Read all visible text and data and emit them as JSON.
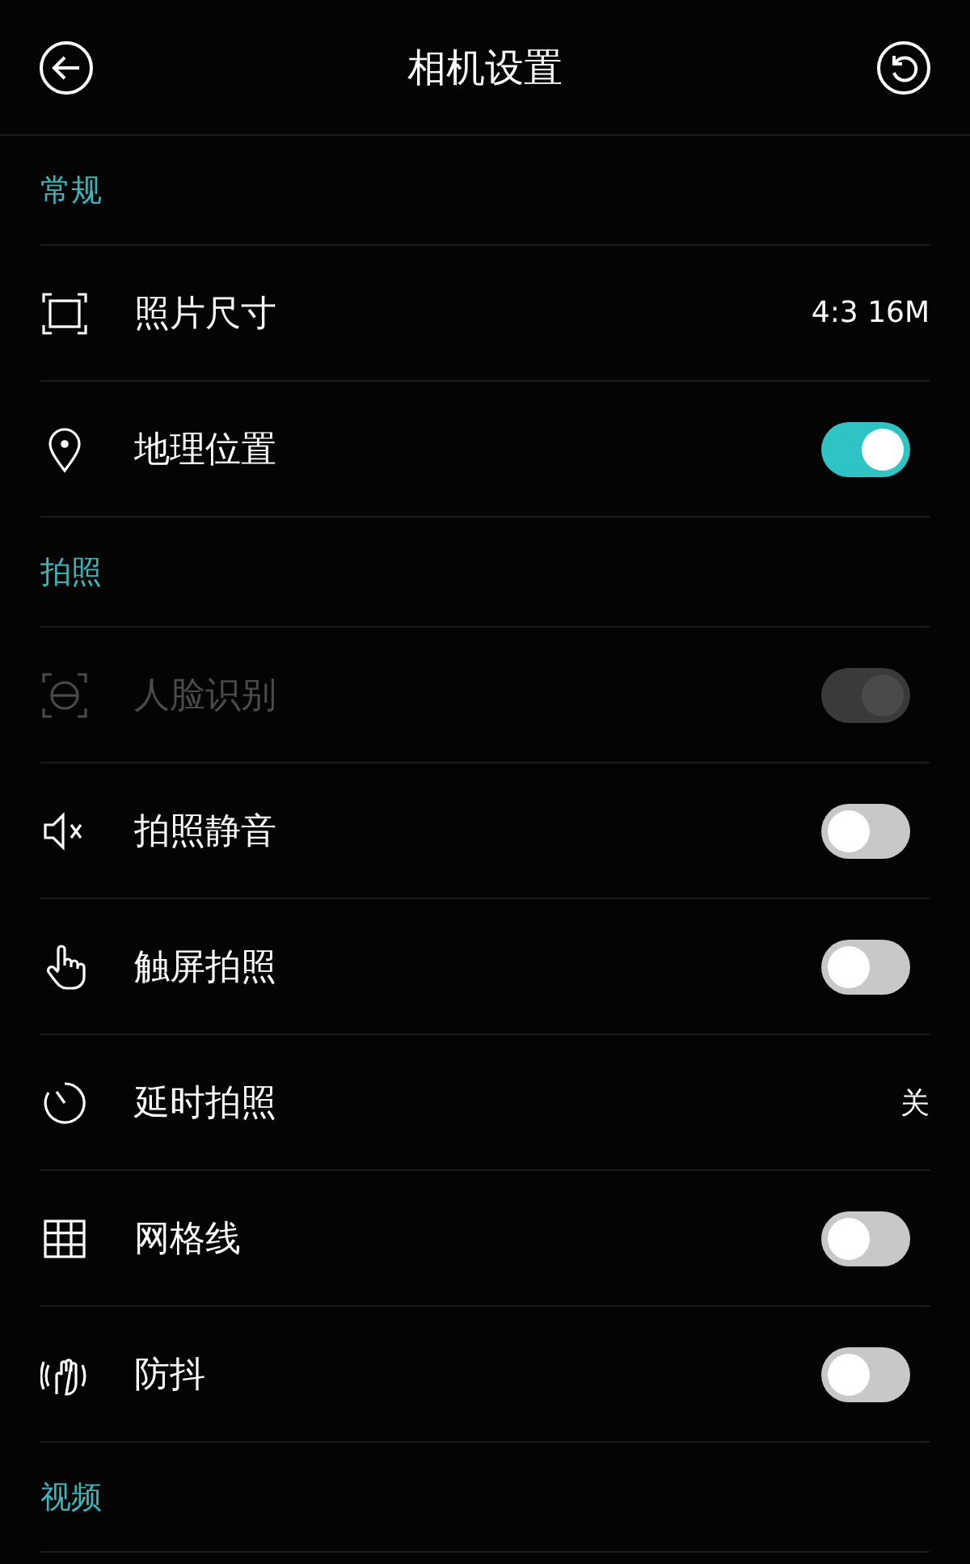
{
  "header": {
    "title": "相机设置"
  },
  "sections": [
    {
      "title": "常规",
      "items": [
        {
          "kind": "value",
          "label": "照片尺寸",
          "value": "4:3 16M",
          "disabled": false
        },
        {
          "kind": "switch",
          "label": "地理位置",
          "on": true,
          "disabled": false
        }
      ]
    },
    {
      "title": "拍照",
      "items": [
        {
          "kind": "switch",
          "label": "人脸识别",
          "on": true,
          "disabled": true
        },
        {
          "kind": "switch",
          "label": "拍照静音",
          "on": false,
          "disabled": false
        },
        {
          "kind": "switch",
          "label": "触屏拍照",
          "on": false,
          "disabled": false
        },
        {
          "kind": "value",
          "label": "延时拍照",
          "value": "关",
          "disabled": false
        },
        {
          "kind": "switch",
          "label": "网格线",
          "on": false,
          "disabled": false
        },
        {
          "kind": "switch",
          "label": "防抖",
          "on": false,
          "disabled": false
        }
      ]
    },
    {
      "title": "视频"
    }
  ]
}
